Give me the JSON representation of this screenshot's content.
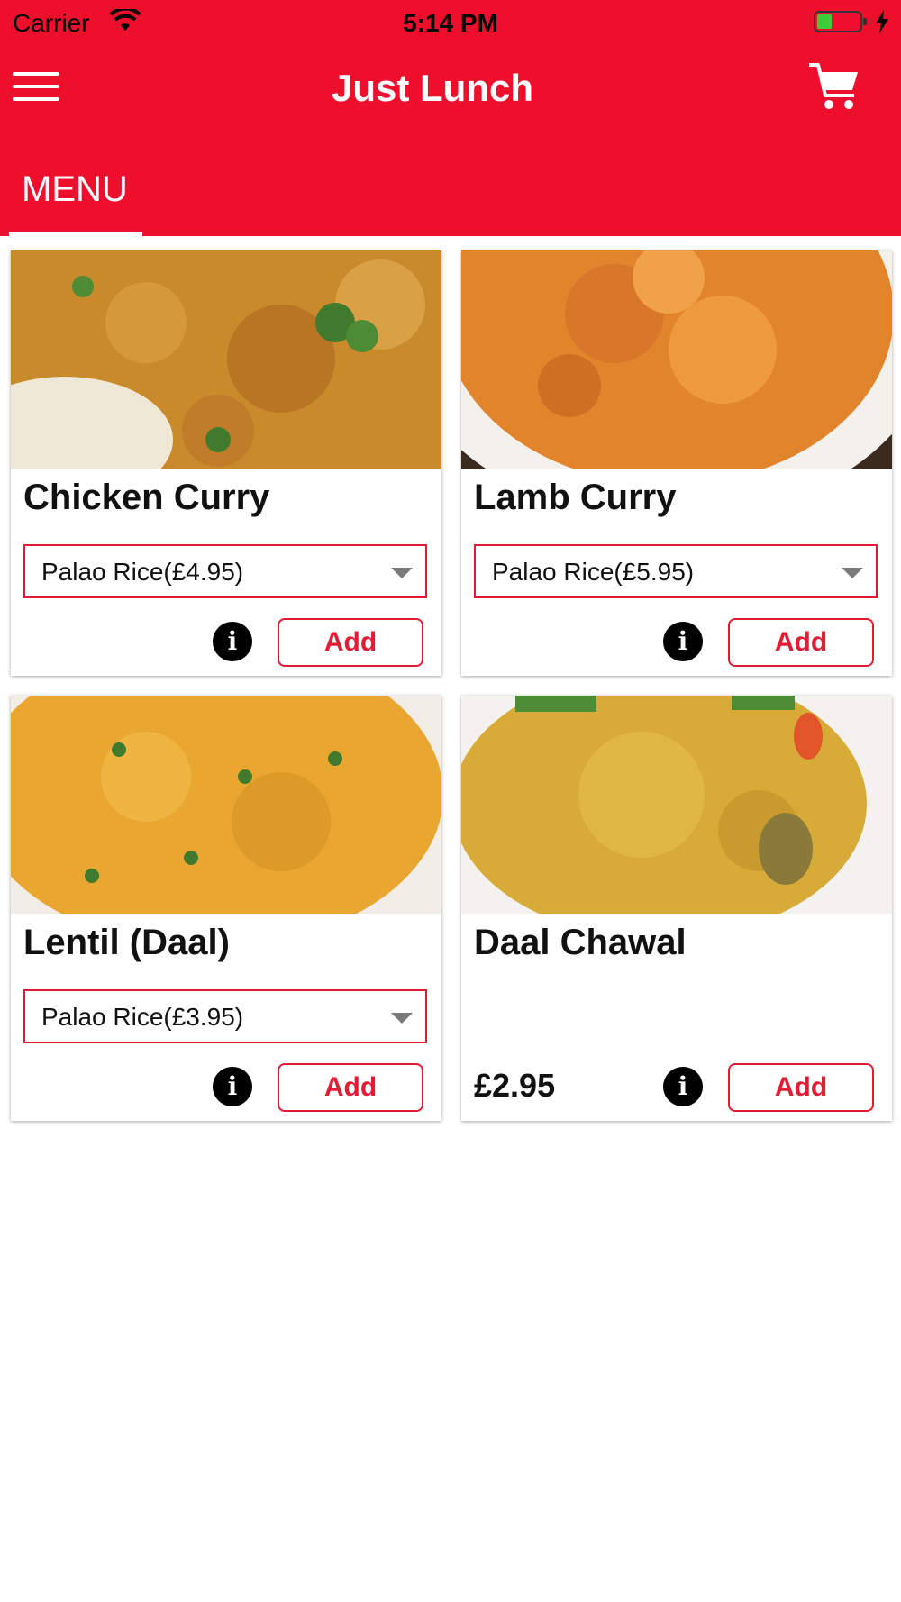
{
  "status_bar": {
    "carrier": "Carrier",
    "time": "5:14 PM"
  },
  "header": {
    "title": "Just Lunch"
  },
  "tabs": [
    {
      "label": "MENU"
    }
  ],
  "colors": {
    "brand_red": "#ee0f2d",
    "accent_red": "#e31c35"
  },
  "menu_items": [
    {
      "name": "Chicken Curry",
      "option": "Palao Rice(£4.95)",
      "price": "",
      "add_label": "Add",
      "info_label": "i"
    },
    {
      "name": "Lamb Curry",
      "option": "Palao Rice(£5.95)",
      "price": "",
      "add_label": "Add",
      "info_label": "i"
    },
    {
      "name": "Lentil (Daal)",
      "option": "Palao Rice(£3.95)",
      "price": "",
      "add_label": "Add",
      "info_label": "i"
    },
    {
      "name": "Daal Chawal",
      "option": "",
      "price": "£2.95",
      "add_label": "Add",
      "info_label": "i"
    }
  ]
}
